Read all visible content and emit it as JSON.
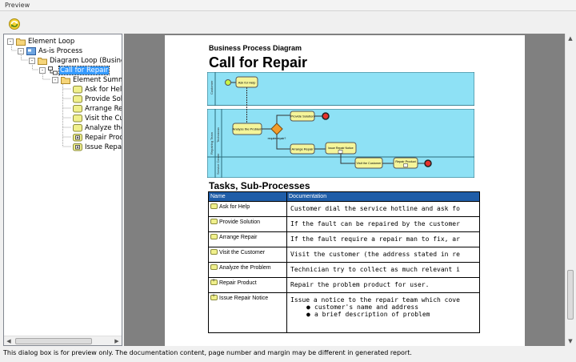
{
  "window": {
    "title": "Preview"
  },
  "toolbar": {
    "refresh_icon": "refresh-icon"
  },
  "tree": {
    "items": [
      {
        "label": "Element Loop",
        "level": 0,
        "icon": "folder-open-icon",
        "expander": "-"
      },
      {
        "label": "As-is Process",
        "level": 1,
        "icon": "model-icon",
        "expander": "-"
      },
      {
        "label": "Diagram Loop (Business P",
        "level": 2,
        "icon": "folder-open-icon",
        "expander": "-"
      },
      {
        "label": "Call for Repair",
        "level": 3,
        "icon": "bpd-diagram-icon",
        "expander": "-",
        "selected": true
      },
      {
        "label": "Element Summar",
        "level": 4,
        "icon": "folder-open-icon",
        "expander": "-"
      },
      {
        "label": "Ask for Help",
        "level": 5,
        "icon": "task-icon"
      },
      {
        "label": "Provide Solut",
        "level": 5,
        "icon": "task-icon"
      },
      {
        "label": "Arrange Rep",
        "level": 5,
        "icon": "task-icon"
      },
      {
        "label": "Visit the Cust",
        "level": 5,
        "icon": "task-icon"
      },
      {
        "label": "Analyze the I",
        "level": 5,
        "icon": "task-icon"
      },
      {
        "label": "Repair Produ",
        "level": 5,
        "icon": "subprocess-icon"
      },
      {
        "label": "Issue Repair",
        "level": 5,
        "icon": "subprocess-icon"
      }
    ]
  },
  "document": {
    "kicker": "Business Process Diagram",
    "title": "Call for Repair",
    "diagram": {
      "pool_labels": [
        "Customer",
        "Technician",
        "Repairing Team",
        "Service Center"
      ],
      "tasks": [
        "Ask for Help",
        "Provide Solution",
        "Analyze the Problem",
        "Arrange Repair",
        "Issue Repair Notice",
        "Visit the Customer",
        "Repair Product"
      ],
      "gateway_label": "require repair?",
      "colors": {
        "lane_fill": "#8ee1f5",
        "task_fill": "#f5f59a",
        "gateway": "#f39c2a",
        "end_event": "#e8322c",
        "start_event": "#c9f545"
      }
    },
    "section_title": "Tasks, Sub-Processes",
    "table": {
      "headers": {
        "name": "Name",
        "documentation": "Documentation"
      },
      "rows": [
        {
          "name": "Ask for Help",
          "icon": "task-icon",
          "doc": "Customer dial the service hotline and ask fo"
        },
        {
          "name": "Provide Solution",
          "icon": "task-icon",
          "doc": "If the fault can be repaired by the customer"
        },
        {
          "name": "Arrange Repair",
          "icon": "task-icon",
          "doc": "If the fault require a repair man to fix, ar"
        },
        {
          "name": "Visit the Customer",
          "icon": "task-icon",
          "doc": "Visit the customer (the address stated in re"
        },
        {
          "name": "Analyze the Problem",
          "icon": "task-icon",
          "doc": "Technician try to collect as much relevant i"
        },
        {
          "name": "Repair Product",
          "icon": "subprocess-icon",
          "doc": "Repair the problem product for user."
        },
        {
          "name": "Issue Repair Notice",
          "icon": "subprocess-icon",
          "doc": "Issue a notice to the repair team which cove",
          "bullets": [
            "customer's name and address",
            "a brief description of problem"
          ]
        }
      ]
    }
  },
  "status": {
    "text": "This dialog box is for preview only. The documentation content, page number and margin may be different in generated report."
  },
  "colors": {
    "header_blue": "#1f5da8",
    "selection": "#3399ff",
    "preview_bg": "#808080"
  }
}
